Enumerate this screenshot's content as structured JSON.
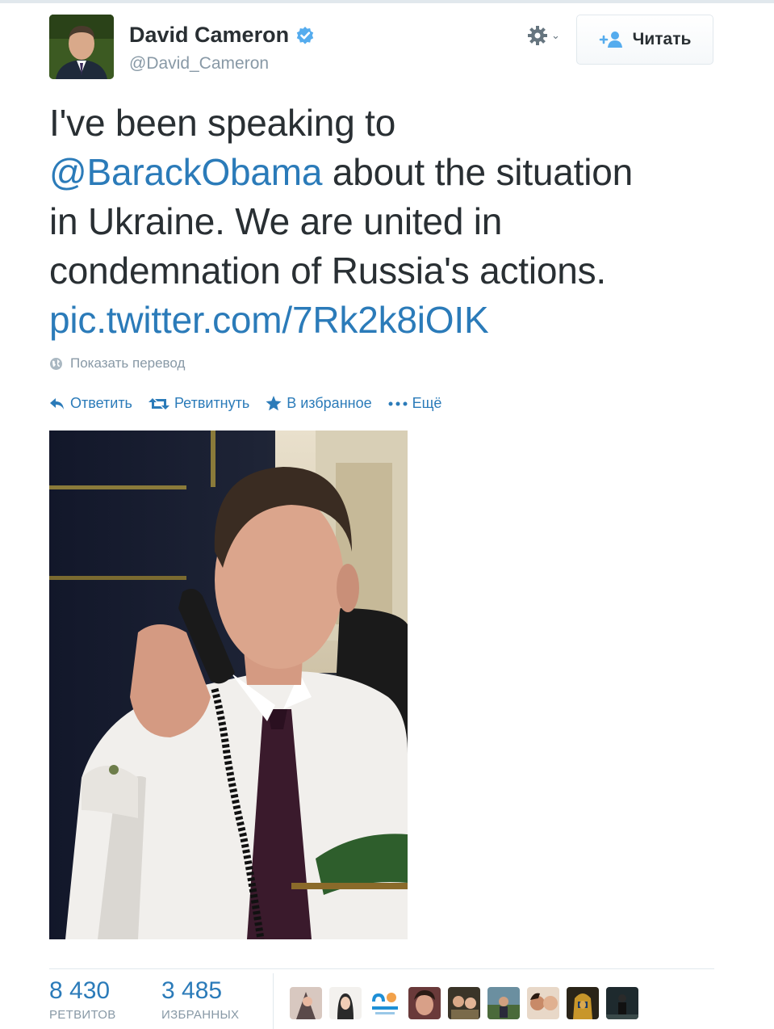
{
  "user": {
    "name": "David Cameron",
    "handle": "@David_Cameron",
    "verified_icon": "verified-badge-icon",
    "avatar_icon": "profile-photo"
  },
  "header": {
    "settings_icon": "gear-icon",
    "follow_label": "Читать",
    "follow_icon": "add-user-icon"
  },
  "tweet": {
    "line1": "I've been speaking to",
    "mention": "@BarackObama",
    "after_mention": " about the situation",
    "line3": "in Ukraine. We are united in",
    "line4": "condemnation of Russia's actions.",
    "link": "pic.twitter.com/7Rk2k8iOIK",
    "translate_label": "Показать перевод"
  },
  "actions": [
    {
      "label": "Ответить",
      "icon": "reply-icon"
    },
    {
      "label": "Ретвитнуть",
      "icon": "retweet-icon"
    },
    {
      "label": "В избранное",
      "icon": "star-icon"
    },
    {
      "label": "Ещё",
      "icon": "more-dots-icon"
    }
  ],
  "stats": {
    "retweets_count": "8 430",
    "retweets_label": "РЕТВИТОВ",
    "favorites_count": "3 485",
    "favorites_label": "ИЗБРАННЫХ"
  },
  "colors": {
    "link": "#2b7bb9",
    "text": "#292f33",
    "muted": "#8899a6",
    "verified": "#55acee"
  }
}
